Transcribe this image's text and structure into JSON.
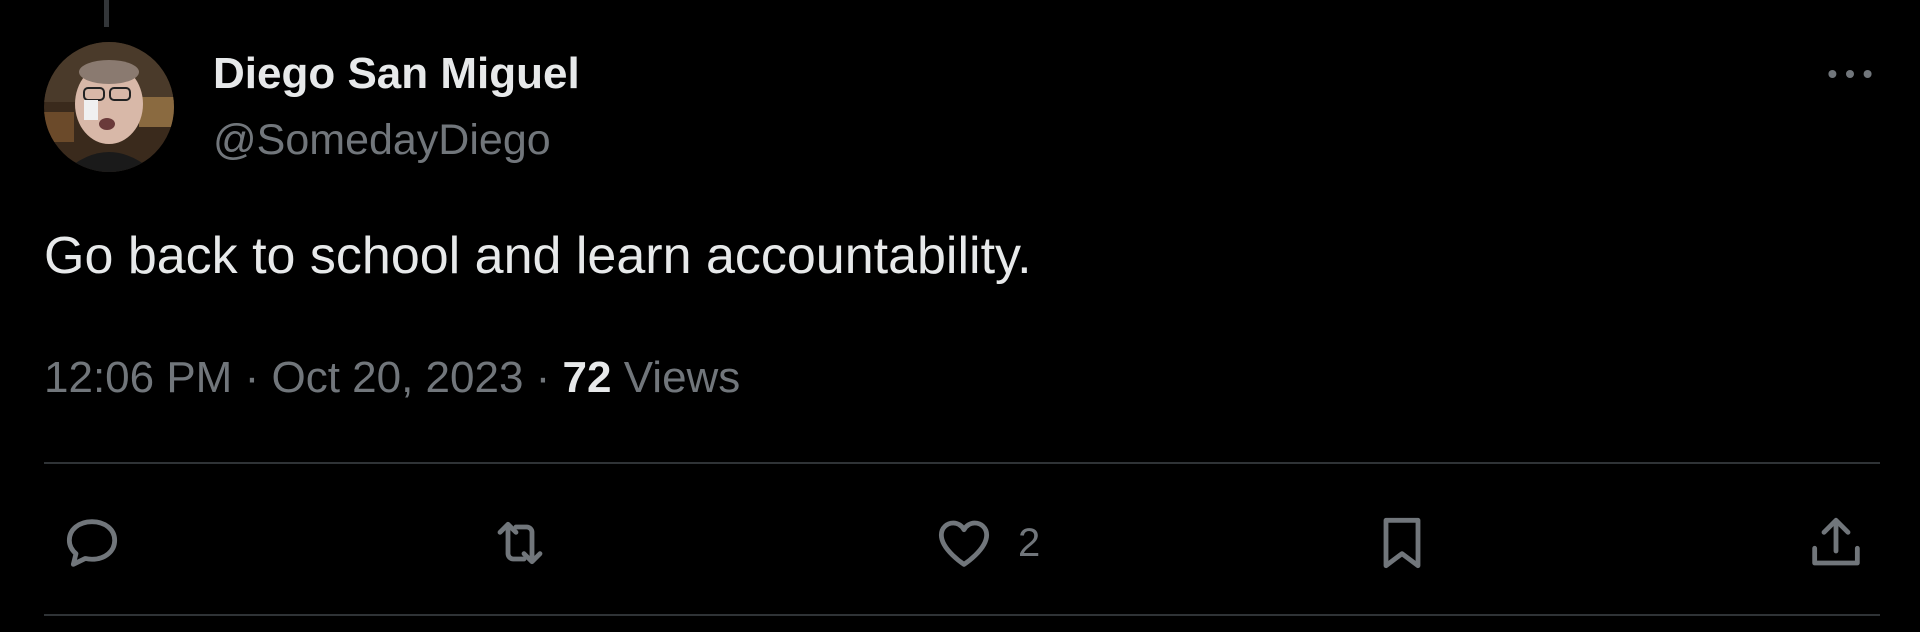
{
  "tweet": {
    "author_name": "Diego San Miguel",
    "author_handle": "@SomedayDiego",
    "text": "Go back to school and learn accountability.",
    "time": "12:06 PM",
    "separator": "·",
    "date": "Oct 20, 2023",
    "views_count": "72",
    "views_label": "Views"
  },
  "actions": {
    "reply": {
      "icon": "reply-icon",
      "count": ""
    },
    "repost": {
      "icon": "repost-icon",
      "count": ""
    },
    "like": {
      "icon": "heart-icon",
      "count": "2"
    },
    "bookmark": {
      "icon": "bookmark-icon",
      "count": ""
    },
    "share": {
      "icon": "share-icon",
      "count": ""
    }
  },
  "colors": {
    "background": "#000000",
    "primary_text": "#e7e9ea",
    "secondary_text": "#71767b",
    "divider": "#2f3336"
  }
}
